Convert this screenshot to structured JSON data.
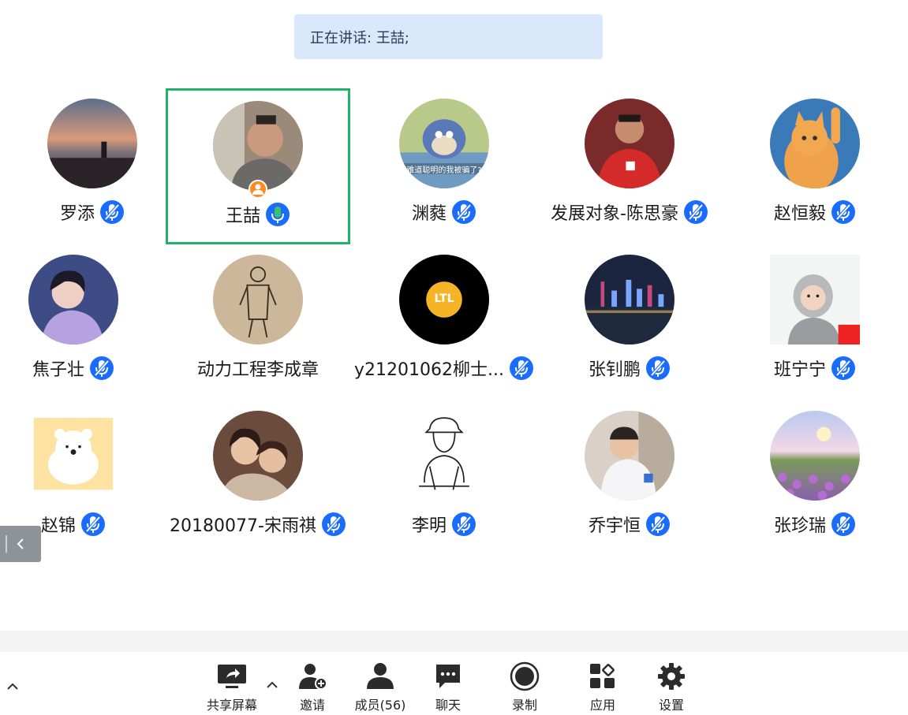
{
  "speaking": {
    "text": "正在讲话: 王喆;"
  },
  "participants": [
    {
      "name": "罗添",
      "mic": "muted",
      "avatar": "sunset-photo"
    },
    {
      "name": "王喆",
      "mic": "speaking",
      "avatar": "man-photo",
      "host": true,
      "active": true
    },
    {
      "name": "渊蕤",
      "mic": "muted",
      "avatar": "cartoon-cat",
      "avatar_caption": "难道聪明的我被骗了?"
    },
    {
      "name": "发展对象-陈思豪",
      "mic": "muted",
      "avatar": "football-player"
    },
    {
      "name": "赵恒毅",
      "mic": "muted",
      "avatar": "orange-cat"
    },
    {
      "name": "焦子壮",
      "mic": "muted",
      "avatar": "anime-boy"
    },
    {
      "name": "动力工程李成章",
      "mic": "none",
      "avatar": "wood-sketch"
    },
    {
      "name": "y21201062柳士...",
      "mic": "muted",
      "avatar": "ltl-logo",
      "avatar_caption": "LTL"
    },
    {
      "name": "张钊鹏",
      "mic": "muted",
      "avatar": "city-skyline"
    },
    {
      "name": "班宁宁",
      "mic": "muted",
      "avatar": "baby-photo"
    },
    {
      "name": "赵锦",
      "mic": "muted",
      "avatar": "bear-sticker"
    },
    {
      "name": "20180077-宋雨祺",
      "mic": "muted",
      "avatar": "girls-photo"
    },
    {
      "name": "李明",
      "mic": "muted",
      "avatar": "line-drawing"
    },
    {
      "name": "乔宇恒",
      "mic": "muted",
      "avatar": "kid-photo"
    },
    {
      "name": "张珍瑞",
      "mic": "muted",
      "avatar": "flower-field"
    }
  ],
  "toolbar": {
    "share_screen": "共享屏幕",
    "invite": "邀请",
    "members": "成员(56)",
    "chat": "聊天",
    "record": "录制",
    "apps": "应用",
    "settings": "设置"
  },
  "colors": {
    "banner_bg": "#d9e8fb",
    "active_border": "#21b26b",
    "mic_blue": "#1a6cff",
    "mic_green": "#3ec16a",
    "host_badge": "#ff8a1f"
  }
}
